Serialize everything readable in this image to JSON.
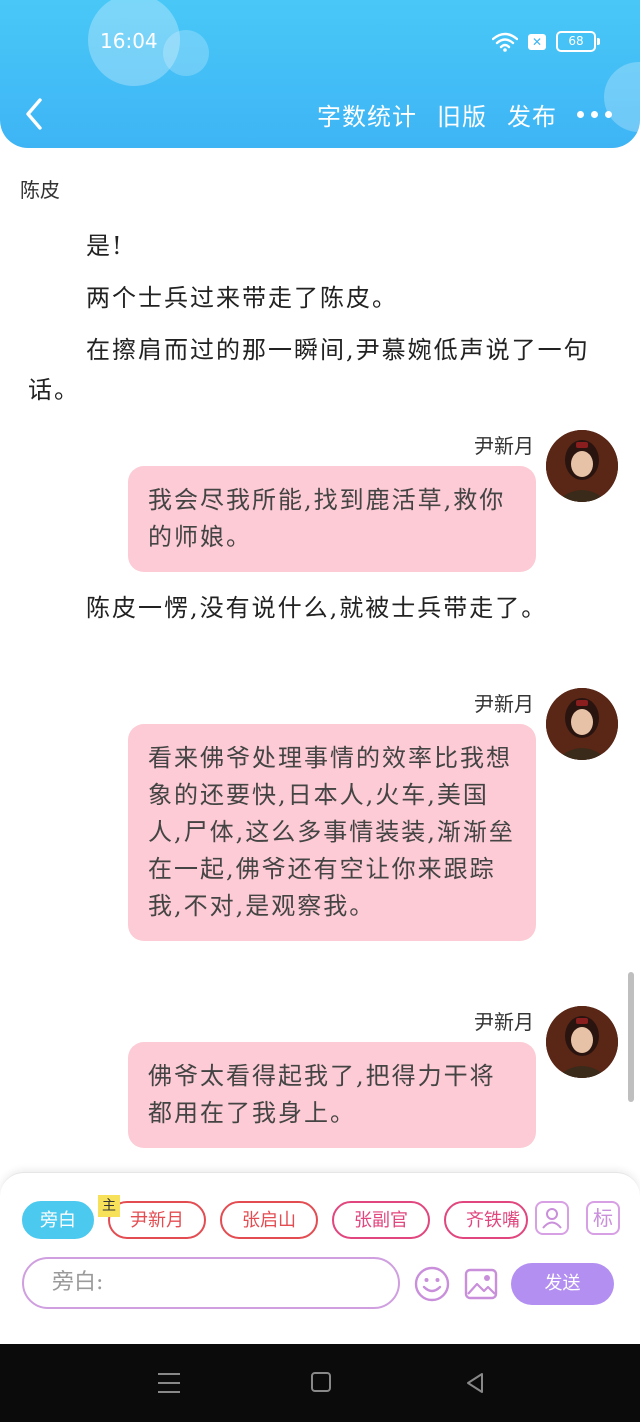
{
  "status_bar": {
    "time": "16:04",
    "battery": "68",
    "notify_icon": "x-box-icon"
  },
  "header": {
    "back_icon": "back-chevron-icon",
    "actions": {
      "word_count": "字数统计",
      "old_version": "旧版",
      "publish": "发布"
    },
    "more_icon": "more-dots-icon"
  },
  "content": {
    "top_speaker": "陈皮",
    "para1": "是!",
    "para2": "两个士兵过来带走了陈皮。",
    "para3": "在擦肩而过的那一瞬间,尹慕婉低声说了一句话。",
    "msg1": {
      "name": "尹新月",
      "text": "我会尽我所能,找到鹿活草,救你的师娘。"
    },
    "para4": "陈皮一愣,没有说什么,就被士兵带走了。",
    "msg2": {
      "name": "尹新月",
      "text": "看来佛爷处理事情的效率比我想象的还要快,日本人,火车,美国人,尸体,这么多事情装装,渐渐垒在一起,佛爷还有空让你来跟踪我,不对,是观察我。"
    },
    "msg3": {
      "name": "尹新月",
      "text": "佛爷太看得起我了,把得力干将都用在了我身上。"
    }
  },
  "composer": {
    "chips": [
      "旁白",
      "尹新月",
      "张启山",
      "张副官",
      "齐铁嘴"
    ],
    "lead_tag": "主",
    "tag_button": "标",
    "input_placeholder": "旁白:",
    "send": "发送"
  },
  "colors": {
    "header": "#3eb4f5",
    "bubble": "#fccbd5",
    "accent": "#b38ff2"
  }
}
